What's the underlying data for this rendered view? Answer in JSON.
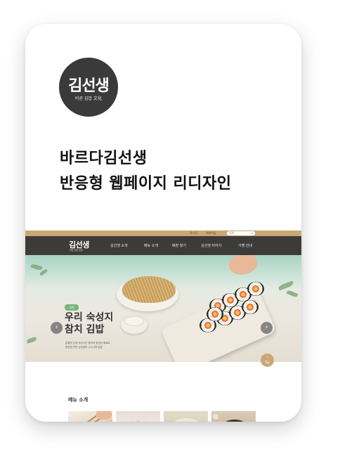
{
  "brand": {
    "logo_text": "김선생",
    "logo_subtext": "바른 김밥 文化",
    "colors": {
      "accent": "#c9a878",
      "nav": "#3d3b3a",
      "logo_bg": "#3a3a3a"
    }
  },
  "headline": {
    "line1": "바르다김선생",
    "line2": "반응형 웹페이지 리디자인"
  },
  "site": {
    "top_links": [
      "로그인",
      "회원가입"
    ],
    "search_placeholder": "검색",
    "search_icon": "search-icon",
    "nav_logo": "김선생",
    "nav_logo_sub": "바른 김밥 文化",
    "nav_items": [
      "김선생 소개",
      "메뉴 소개",
      "매장 찾기",
      "김선생 이야기",
      "가맹 안내"
    ],
    "hero": {
      "badge": "추천",
      "title_line1": "우리 숙성지",
      "title_line2": "참치 김밥",
      "desc_line1": "감칠맛 있게 숙성시킨 참치와 엄선된 재료로",
      "desc_line2": "정성껏 만든 김선생의 시그니처 김밥",
      "prev_icon": "chevron-left-icon",
      "next_icon": "chevron-right-icon",
      "slides": 3
    },
    "top_button": "Top",
    "menu_section_title": "메뉴 소개",
    "menu_thumbs": [
      "kimbap-photo",
      "noodle-photo",
      "dumpling-photo",
      "tteokbokki-photo"
    ]
  }
}
